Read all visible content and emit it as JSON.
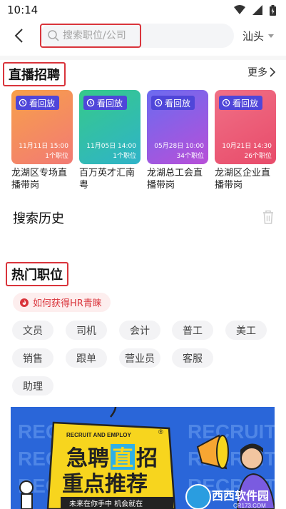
{
  "status_bar": {
    "time": "10:14"
  },
  "search": {
    "placeholder": "搜索职位/公司",
    "city": "汕头"
  },
  "live": {
    "title": "直播招聘",
    "more": "更多",
    "cards": [
      {
        "badge": "看回放",
        "time": "11月11日 15:00",
        "count": "1个职位",
        "name": "龙湖区专场直播带岗",
        "color_a": "#f7a04a",
        "color_b": "#f27a74"
      },
      {
        "badge": "看回放",
        "time": "11月05日 14:00",
        "count": "1个职位",
        "name": "百万英才汇南粤",
        "color_a": "#36c98a",
        "color_b": "#2fb3c9"
      },
      {
        "badge": "看回放",
        "time": "05月28日 10:00",
        "count": "34个职位",
        "name": "龙湖总工会直播带岗",
        "color_a": "#6b6bf0",
        "color_b": "#b84fd8"
      },
      {
        "badge": "看回放",
        "time": "10月21日 14:30",
        "count": "26个职位",
        "name": "龙湖区企业直播带岗",
        "color_a": "#f07086",
        "color_b": "#e84b6a"
      }
    ]
  },
  "history": {
    "title": "搜索历史"
  },
  "hot": {
    "title": "热门职位",
    "hr_chip": "如何获得HR青睐",
    "tags": [
      "文员",
      "司机",
      "会计",
      "普工",
      "美工",
      "销售",
      "跟单",
      "营业员",
      "客服",
      "助理"
    ]
  },
  "banner": {
    "bg_words": [
      "RECRUIT",
      "RECRUIT",
      "RECRUIT",
      "RECRUIT",
      "RECRUIT",
      "RECRUIT"
    ],
    "top_small": "RECRUIT AND EMPLOY",
    "line1_a": "急聘",
    "line1_b": "直",
    "line1_c": "招",
    "line2": "重点推荐",
    "slogan": "未来在你手中 机会就在",
    "watermark": "西西软件园",
    "watermark_sub": "CR173.COM"
  },
  "colors": {
    "accent": "#d9343b",
    "badge": "#4f46d9",
    "banner_blue": "#2a66d9",
    "banner_yellow": "#f7d51e"
  }
}
